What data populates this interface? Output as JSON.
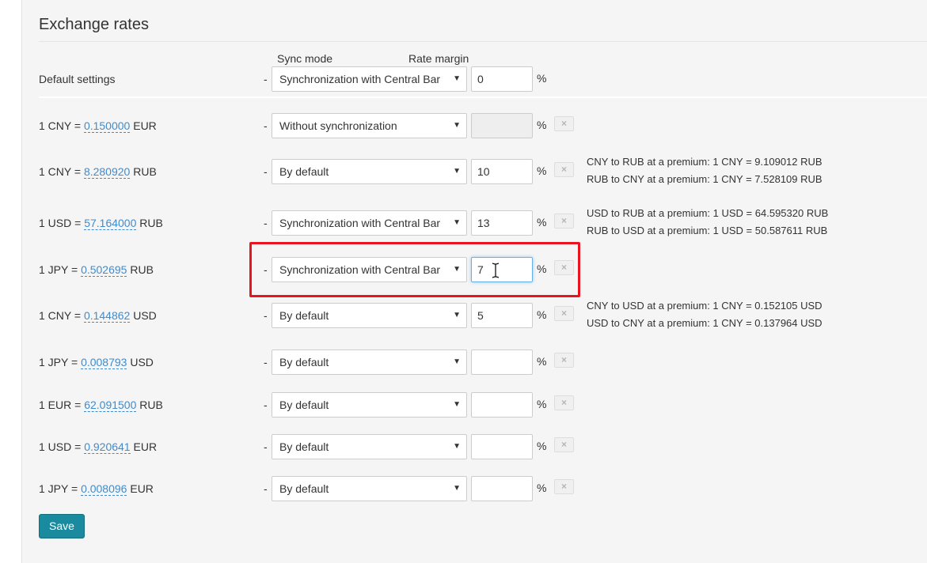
{
  "page": {
    "title": "Exchange rates",
    "columns": {
      "sync_mode": "Sync mode",
      "rate_margin": "Rate margin"
    },
    "default_row": {
      "label": "Default settings",
      "dash": "-",
      "sync_mode": "Synchronization with Central Bar",
      "margin": "0",
      "unit": "%"
    },
    "rows": [
      {
        "prefix": "1 CNY =",
        "rate": "0.150000",
        "target": "EUR",
        "dash": "-",
        "sync_mode": "Without synchronization",
        "margin": "",
        "unit": "%",
        "delete": "×",
        "info": []
      },
      {
        "prefix": "1 CNY =",
        "rate": "8.280920",
        "target": "RUB",
        "dash": "-",
        "sync_mode": "By default",
        "margin": "10",
        "unit": "%",
        "delete": "×",
        "info": [
          "CNY to RUB at a premium: 1 CNY = 9.109012 RUB",
          "RUB to CNY at a premium: 1 CNY = 7.528109 RUB"
        ]
      },
      {
        "prefix": "1 USD =",
        "rate": "57.164000",
        "target": "RUB",
        "dash": "-",
        "sync_mode": "Synchronization with Central Bar",
        "margin": "13",
        "unit": "%",
        "delete": "×",
        "info": [
          "USD to RUB at a premium: 1 USD = 64.595320 RUB",
          "RUB to USD at a premium: 1 USD = 50.587611 RUB"
        ]
      },
      {
        "prefix": "1 JPY =",
        "rate": "0.502695",
        "target": "RUB",
        "dash": "-",
        "sync_mode": "Synchronization with Central Bar",
        "margin": "7",
        "unit": "%",
        "delete": "×",
        "info": []
      },
      {
        "prefix": "1 CNY =",
        "rate": "0.144862",
        "target": "USD",
        "dash": "-",
        "sync_mode": "By default",
        "margin": "5",
        "unit": "%",
        "delete": "×",
        "info": [
          "CNY to USD at a premium: 1 CNY = 0.152105 USD",
          "USD to CNY at a premium: 1 CNY = 0.137964 USD"
        ]
      },
      {
        "prefix": "1 JPY =",
        "rate": "0.008793",
        "target": "USD",
        "dash": "-",
        "sync_mode": "By default",
        "margin": "",
        "unit": "%",
        "delete": "×",
        "info": []
      },
      {
        "prefix": "1 EUR =",
        "rate": "62.091500",
        "target": "RUB",
        "dash": "-",
        "sync_mode": "By default",
        "margin": "",
        "unit": "%",
        "delete": "×",
        "info": []
      },
      {
        "prefix": "1 USD =",
        "rate": "0.920641",
        "target": "EUR",
        "dash": "-",
        "sync_mode": "By default",
        "margin": "",
        "unit": "%",
        "delete": "×",
        "info": []
      },
      {
        "prefix": "1 JPY =",
        "rate": "0.008096",
        "target": "EUR",
        "dash": "-",
        "sync_mode": "By default",
        "margin": "",
        "unit": "%",
        "delete": "×",
        "info": []
      }
    ],
    "save_label": "Save",
    "icons": {
      "dropdown": "chevron-down-icon",
      "delete": "close-icon",
      "cursor": "text-cursor-icon"
    },
    "colors": {
      "link": "#428bca",
      "save_button": "#1a8a9e",
      "highlight": "#e8141e"
    }
  }
}
